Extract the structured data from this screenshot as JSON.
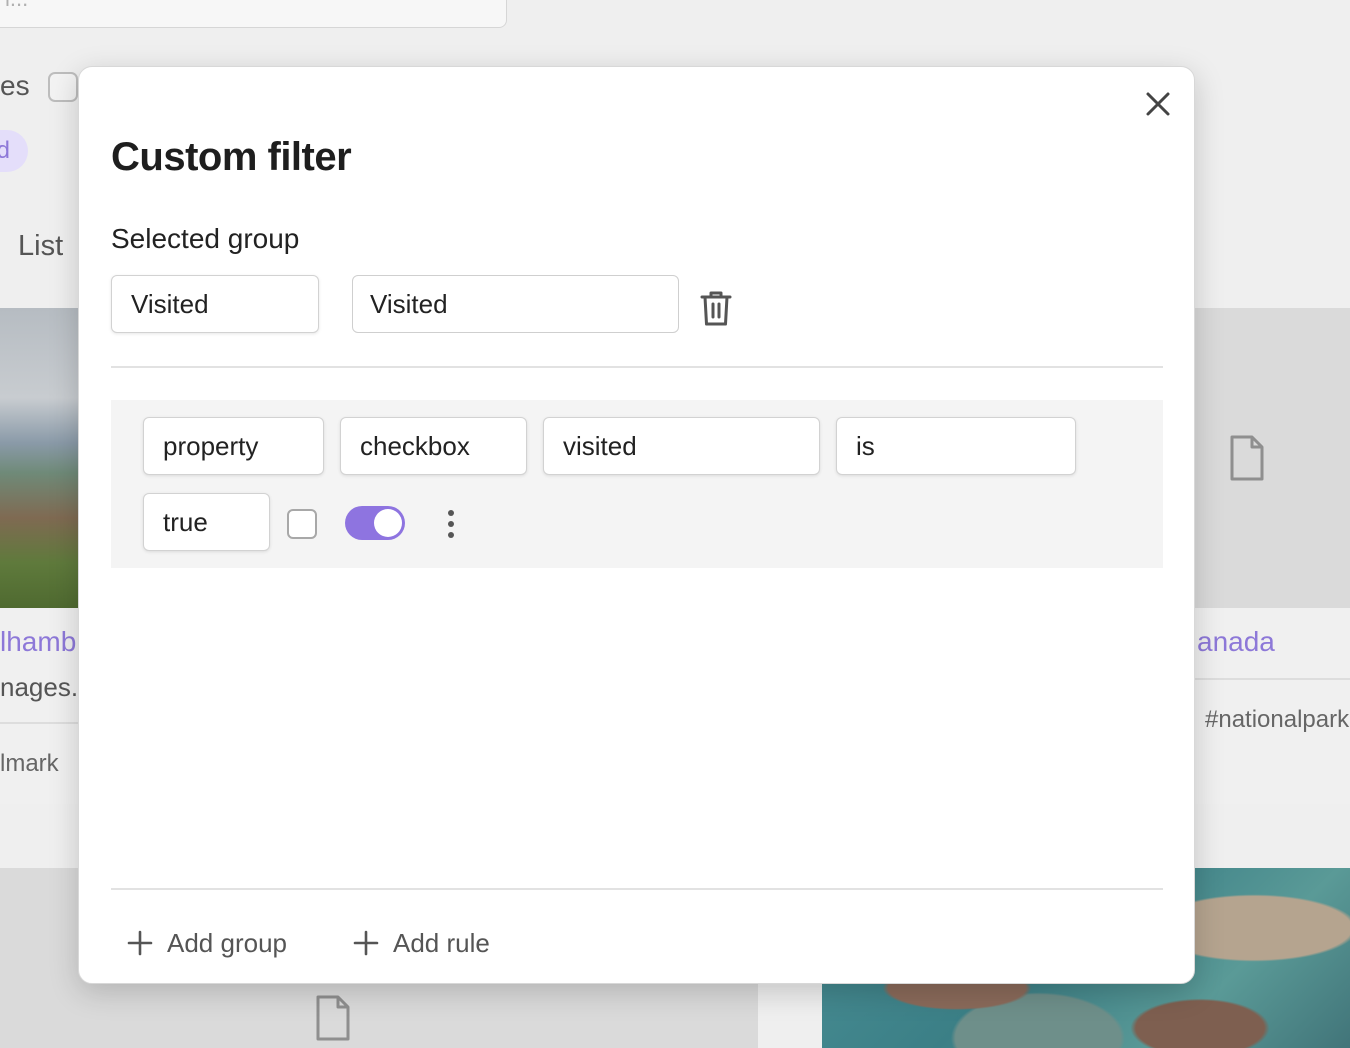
{
  "background": {
    "search_placeholder": "l...",
    "filter_label_fragment": "es",
    "pill_fragment": "d",
    "view_tab_list": "List",
    "card_left": {
      "title_fragment": "lhamb",
      "subtitle_fragment": "nages.",
      "tag_fragment": "lmark"
    },
    "card_right": {
      "title_fragment": "anada",
      "tag_fragment": "#nationalpark"
    }
  },
  "modal": {
    "title": "Custom filter",
    "selected_group_label": "Selected group",
    "group_select_value": "Visited",
    "group_name_value": "Visited",
    "rule": {
      "type_value": "property",
      "property_type_value": "checkbox",
      "property_name_value": "visited",
      "operator_value": "is",
      "compare_value": "true",
      "rule_checkbox_checked": false,
      "rule_enabled": true
    },
    "add_group_label": "Add group",
    "add_rule_label": "Add rule"
  },
  "colors": {
    "accent": "#8e74e0",
    "link": "#8d78d8",
    "title": "#1e1e1e"
  },
  "icons": {
    "close": "close-icon",
    "delete": "trash-icon",
    "more": "more-vertical-icon",
    "add": "plus-icon",
    "file": "file-icon"
  }
}
